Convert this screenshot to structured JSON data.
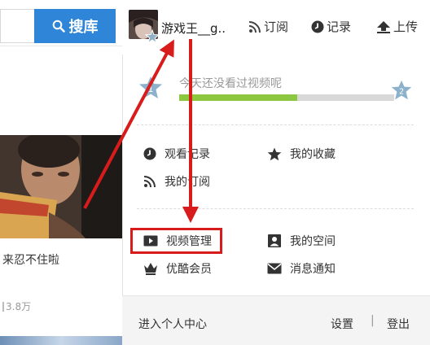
{
  "search": {
    "button_label": "搜库",
    "icon": "search-icon"
  },
  "feed": {
    "video_caption": "来忍不住啦",
    "video_views": "3.8万"
  },
  "header": {
    "username": "游戏王__g..",
    "nav": [
      {
        "label": "订阅",
        "icon": "rss-icon"
      },
      {
        "label": "记录",
        "icon": "clock-icon"
      },
      {
        "label": "上传",
        "icon": "upload-icon"
      }
    ]
  },
  "level": {
    "message": "今天还没看过视频呢",
    "current": "1",
    "next": "2",
    "progress": 0.55,
    "fill_color": "#8dc63f"
  },
  "menu": {
    "watch_history": "观看记录",
    "favorites": "我的收藏",
    "subscriptions": "我的订阅",
    "video_manage": "视频管理",
    "my_space": "我的空间",
    "vip": "优酷会员",
    "notifications": "消息通知"
  },
  "footer": {
    "personal_center": "进入个人中心",
    "settings": "设置",
    "separator": "|",
    "logout": "登出"
  },
  "colors": {
    "accent": "#2f86d8",
    "annotation": "#d81b1b"
  }
}
